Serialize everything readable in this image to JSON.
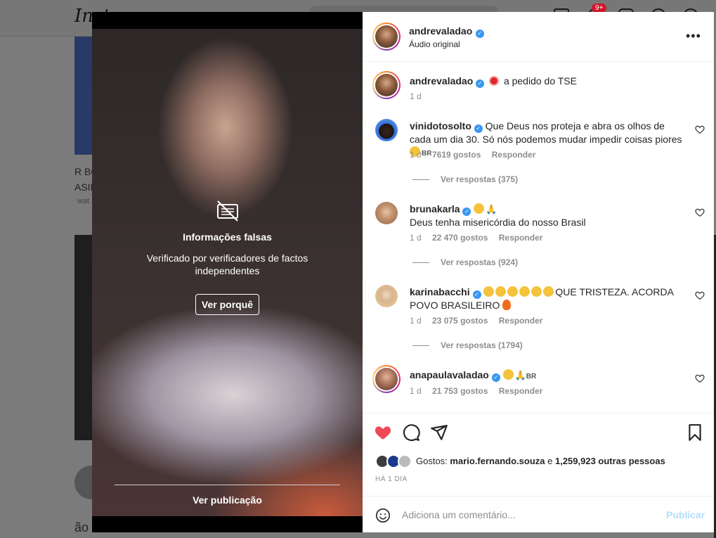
{
  "background": {
    "logo": "Inst",
    "notification_badge": "9+",
    "snippets": [
      "R BO",
      "ASIL",
      "wat",
      "ão"
    ]
  },
  "media": {
    "fact_check": {
      "title": "Informações falsas",
      "subtitle": "Verificado por verificadores de factos independentes",
      "button_label": "Ver porquê",
      "view_post_label": "Ver publicação"
    }
  },
  "header": {
    "username": "andrevaladao",
    "audio": "Áudio original",
    "more_icon": "more-horizontal-icon"
  },
  "caption": {
    "username": "andrevaladao",
    "text": "a pedido do TSE",
    "time": "1 d"
  },
  "comments": [
    {
      "username": "vinidotosolto",
      "text": "Que Deus nos proteja e abra os olhos de cada um dia 30. Só nós podemos mudar impedir coisas piores",
      "suffix": "BR",
      "time": "1 d",
      "likes": "7619 gostos",
      "reply": "Responder",
      "view_replies": "Ver respostas (375)"
    },
    {
      "username": "brunakarla",
      "text": "Deus tenha misericórdia do nosso Brasil",
      "time": "1 d",
      "likes": "22 470 gostos",
      "reply": "Responder",
      "view_replies": "Ver respostas (924)"
    },
    {
      "username": "karinabacchi",
      "text": "QUE TRISTEZA. ACORDA POVO BRASILEIRO",
      "time": "1 d",
      "likes": "23 075 gostos",
      "reply": "Responder",
      "view_replies": "Ver respostas (1794)"
    },
    {
      "username": "anapaulavaladao",
      "suffix": "BR",
      "time": "1 d",
      "likes": "21 753 gostos",
      "reply": "Responder"
    }
  ],
  "actions": {
    "liked": true,
    "likes_prefix": "Gostos:",
    "likes_user": "mario.fernando.souza",
    "likes_and": "e",
    "likes_others": "1,259,923 outras pessoas",
    "time": "HÁ 1 DIA"
  },
  "composer": {
    "placeholder": "Adiciona um comentário...",
    "post_label": "Publicar"
  },
  "colors": {
    "liked_heart": "#ed4956",
    "verified": "#3897f0",
    "post_disabled": "#b2dffc"
  }
}
